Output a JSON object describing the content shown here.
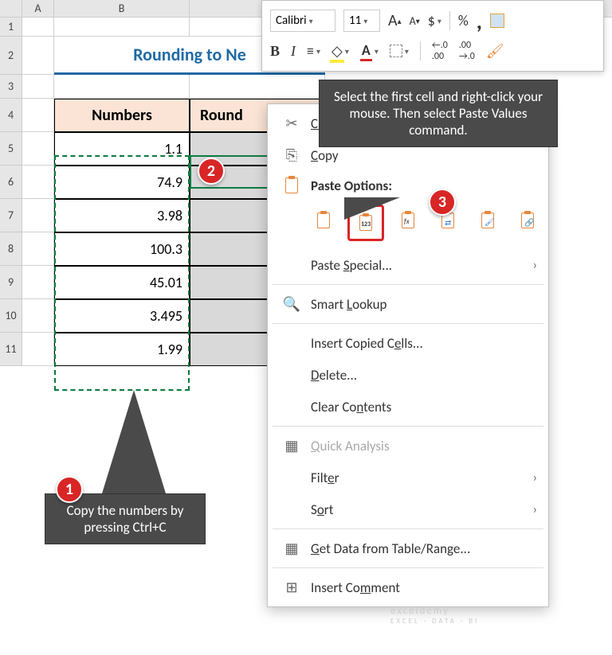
{
  "columns": {
    "A": "A",
    "B": "B"
  },
  "rows": [
    "1",
    "2",
    "3",
    "4",
    "5",
    "6",
    "7",
    "8",
    "9",
    "10",
    "11"
  ],
  "title": "Rounding to Ne",
  "table": {
    "header_numbers": "Numbers",
    "header_rounded": "Round",
    "values": [
      "1.1",
      "74.9",
      "3.98",
      "100.3",
      "45.01",
      "3.495",
      "1.99"
    ]
  },
  "mini_toolbar": {
    "font_name": "Calibri",
    "font_size": "11",
    "bold": "B",
    "italic": "I",
    "dollar": "$",
    "percent": "%",
    "comma": ",",
    "letterA_bigger": "A",
    "letterA_smaller": "A",
    "dec_inc": ".00",
    "dec_dec": ".00"
  },
  "context_menu": {
    "cut": "Cut",
    "copy": "Copy",
    "paste_options": "Paste Options:",
    "paste_special": "Paste Special...",
    "smart_lookup": "Smart Lookup",
    "insert_copied": "Insert Copied Cells...",
    "delete": "Delete...",
    "clear_contents": "Clear Contents",
    "quick_analysis": "Quick Analysis",
    "filter": "Filter",
    "sort": "Sort",
    "get_data": "Get Data from Table/Range...",
    "insert_comment": "Insert Comment",
    "paste_values_123": "123",
    "paste_fx": "fx"
  },
  "callouts": {
    "c1": "Copy the numbers by pressing Ctrl+C",
    "c2": "Select the first cell and right-click your mouse. Then select Paste Values command.",
    "b1": "1",
    "b2": "2",
    "b3": "3"
  },
  "watermark": {
    "main": "exceldemy",
    "sub": "EXCEL · DATA · BI"
  }
}
